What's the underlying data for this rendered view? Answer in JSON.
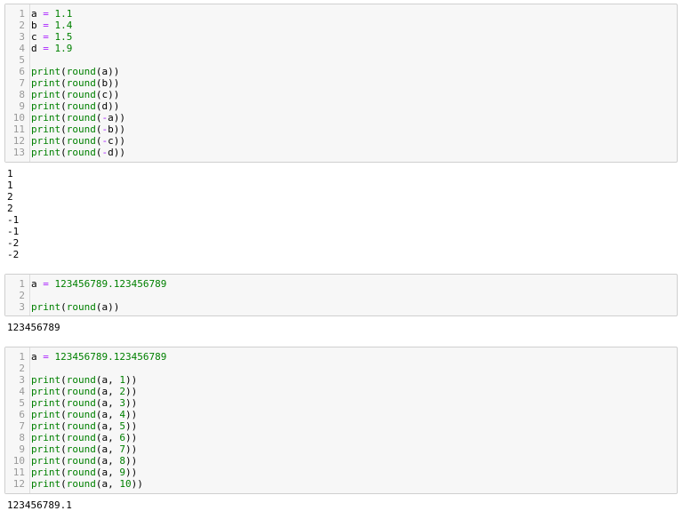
{
  "cells": [
    {
      "id": "cell1",
      "lines": [
        {
          "n": "1",
          "code": "a = 1.1"
        },
        {
          "n": "2",
          "code": "b = 1.4"
        },
        {
          "n": "3",
          "code": "c = 1.5"
        },
        {
          "n": "4",
          "code": "d = 1.9"
        },
        {
          "n": "5",
          "code": ""
        },
        {
          "n": "6",
          "code": "print(round(a))"
        },
        {
          "n": "7",
          "code": "print(round(b))"
        },
        {
          "n": "8",
          "code": "print(round(c))"
        },
        {
          "n": "9",
          "code": "print(round(d))"
        },
        {
          "n": "10",
          "code": "print(round(-a))"
        },
        {
          "n": "11",
          "code": "print(round(-b))"
        },
        {
          "n": "12",
          "code": "print(round(-c))"
        },
        {
          "n": "13",
          "code": "print(round(-d))"
        }
      ],
      "output": [
        "1",
        "1",
        "2",
        "2",
        "-1",
        "-1",
        "-2",
        "-2"
      ]
    },
    {
      "id": "cell2",
      "lines": [
        {
          "n": "1",
          "code": "a = 123456789.123456789"
        },
        {
          "n": "2",
          "code": ""
        },
        {
          "n": "3",
          "code": "print(round(a))"
        }
      ],
      "output": [
        "123456789"
      ]
    },
    {
      "id": "cell3",
      "lines": [
        {
          "n": "1",
          "code": "a = 123456789.123456789"
        },
        {
          "n": "2",
          "code": ""
        },
        {
          "n": "3",
          "code": "print(round(a, 1))"
        },
        {
          "n": "4",
          "code": "print(round(a, 2))"
        },
        {
          "n": "5",
          "code": "print(round(a, 3))"
        },
        {
          "n": "6",
          "code": "print(round(a, 4))"
        },
        {
          "n": "7",
          "code": "print(round(a, 5))"
        },
        {
          "n": "8",
          "code": "print(round(a, 6))"
        },
        {
          "n": "9",
          "code": "print(round(a, 7))"
        },
        {
          "n": "10",
          "code": "print(round(a, 8))"
        },
        {
          "n": "11",
          "code": "print(round(a, 9))"
        },
        {
          "n": "12",
          "code": "print(round(a, 10))"
        }
      ],
      "output": [
        "123456789.1"
      ]
    }
  ]
}
